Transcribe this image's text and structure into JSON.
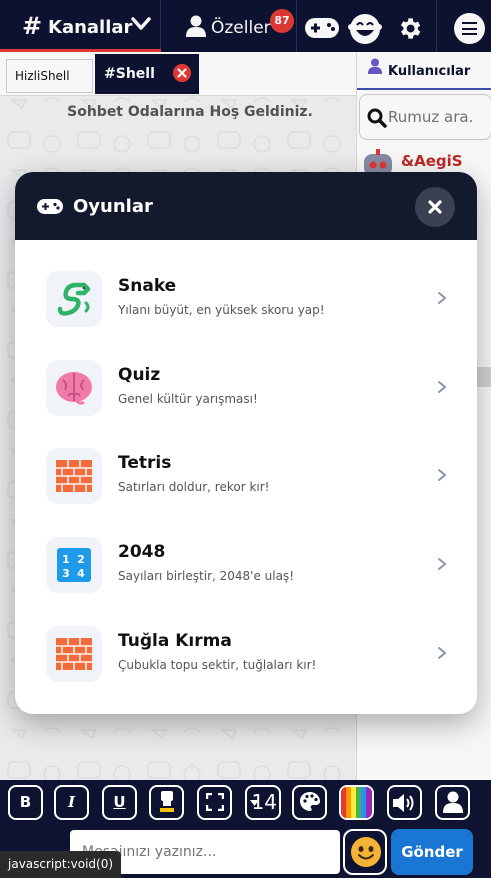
{
  "topbar": {
    "channels_label": "Kanallar",
    "private_label": "Özeller",
    "private_badge": "87"
  },
  "tabs": [
    {
      "label": "HizliShell"
    },
    {
      "label": "#Shell"
    }
  ],
  "chat": {
    "welcome": "Sohbet Odalarına Hoş Geldiniz."
  },
  "users": {
    "title": "Kullanıcılar",
    "search_placeholder": "Rumuz ara.",
    "first_user": "&AegiS"
  },
  "modal": {
    "title": "Oyunlar",
    "games": [
      {
        "name": "Snake",
        "desc": "Yılanı büyüt, en yüksek skoru yap!",
        "icon": "snake-icon"
      },
      {
        "name": "Quiz",
        "desc": "Genel kültür yarışması!",
        "icon": "brain-icon"
      },
      {
        "name": "Tetris",
        "desc": "Satırları doldur, rekor kır!",
        "icon": "brick-icon"
      },
      {
        "name": "2048",
        "desc": "Sayıları birleştir, 2048'e ulaş!",
        "icon": "numbers-icon"
      },
      {
        "name": "Tuğla Kırma",
        "desc": "Çubukla topu sektir, tuğlaları kır!",
        "icon": "brick-icon"
      }
    ]
  },
  "toolbar": {
    "bold": "B",
    "italic": "I",
    "underline": "U",
    "font_size": "14"
  },
  "composer": {
    "placeholder": "Mesajınızı yazınız...",
    "send_label": "Gönder"
  },
  "statusbar": {
    "text": "javascript:void(0)"
  },
  "colors": {
    "navy": "#0d1331",
    "modal_header": "#131a2e",
    "accent_red": "#e53935",
    "send_blue": "#1976d2"
  }
}
